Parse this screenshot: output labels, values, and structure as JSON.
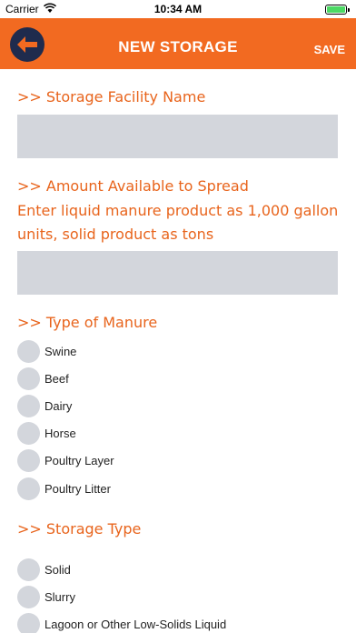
{
  "status_bar": {
    "carrier": "Carrier",
    "time": "10:34 AM",
    "battery_level": 1.0
  },
  "nav": {
    "title": "NEW STORAGE",
    "save_label": "SAVE",
    "back_icon": "arrow-left-icon"
  },
  "colors": {
    "accent": "#f26a21",
    "back_button": "#1f2b4d",
    "field_bg": "#d3d6dc",
    "label_text": "#e8641c"
  },
  "form": {
    "facility_label": ">> Storage Facility Name",
    "facility_value": "",
    "amount_label": ">> Amount Available to Spread",
    "amount_hint_line1": "Enter liquid manure product as 1,000 gallon",
    "amount_hint_line2": "units, solid product as tons",
    "amount_value": "",
    "manure_label": ">> Type of Manure",
    "manure_options": [
      "Swine",
      "Beef",
      "Dairy",
      "Horse",
      "Poultry Layer",
      "Poultry Litter"
    ],
    "storage_label": ">> Storage Type",
    "storage_options": [
      "Solid",
      "Slurry",
      "Lagoon or Other Low-Solids Liquid"
    ]
  }
}
